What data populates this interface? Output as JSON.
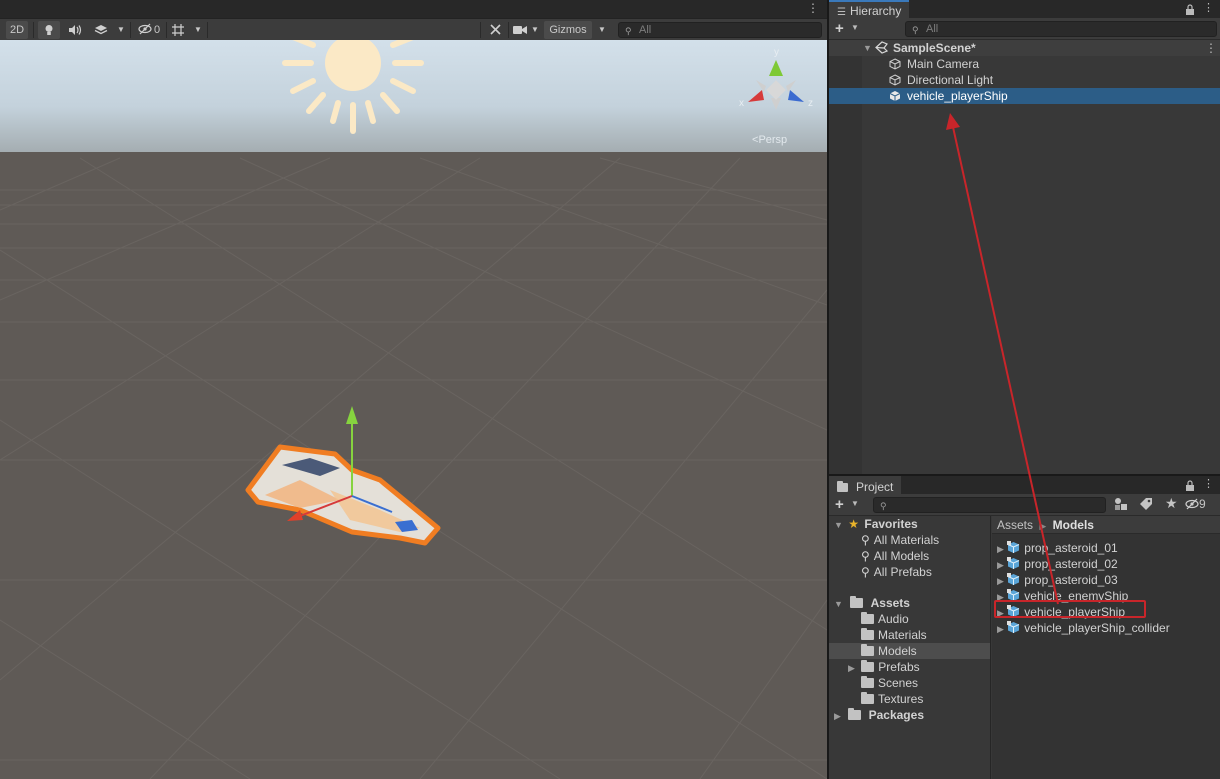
{
  "scene": {
    "toolbar": {
      "mode_2d": "2D",
      "hidden_count": "0",
      "gizmos": "Gizmos",
      "search_placeholder": "All"
    },
    "persp_label": "Persp",
    "axis_labels": {
      "y": "y",
      "x": "x",
      "z": "z"
    }
  },
  "hierarchy": {
    "tab": "Hierarchy",
    "search_placeholder": "All",
    "scene_name": "SampleScene*",
    "items": [
      {
        "label": "Main Camera",
        "icon": "gameobject-icon"
      },
      {
        "label": "Directional Light",
        "icon": "gameobject-icon"
      },
      {
        "label": "vehicle_playerShip",
        "icon": "prefab-icon",
        "selected": true
      }
    ]
  },
  "project": {
    "tab": "Project",
    "search_placeholder": "",
    "hidden_count": "9",
    "favorites": {
      "label": "Favorites",
      "items": [
        "All Materials",
        "All Models",
        "All Prefabs"
      ]
    },
    "assets": {
      "label": "Assets",
      "folders": [
        "Audio",
        "Materials",
        "Models",
        "Prefabs",
        "Scenes",
        "Textures"
      ],
      "selected": "Models"
    },
    "packages": "Packages",
    "breadcrumb": {
      "root": "Assets",
      "current": "Models"
    },
    "files": [
      "prop_asteroid_01",
      "prop_asteroid_02",
      "prop_asteroid_03",
      "vehicle_enemyShip",
      "vehicle_playerShip",
      "vehicle_playerShip_collider"
    ]
  },
  "colors": {
    "selection": "#2c5d87",
    "annotation": "#c8252a",
    "panel": "#383838"
  }
}
